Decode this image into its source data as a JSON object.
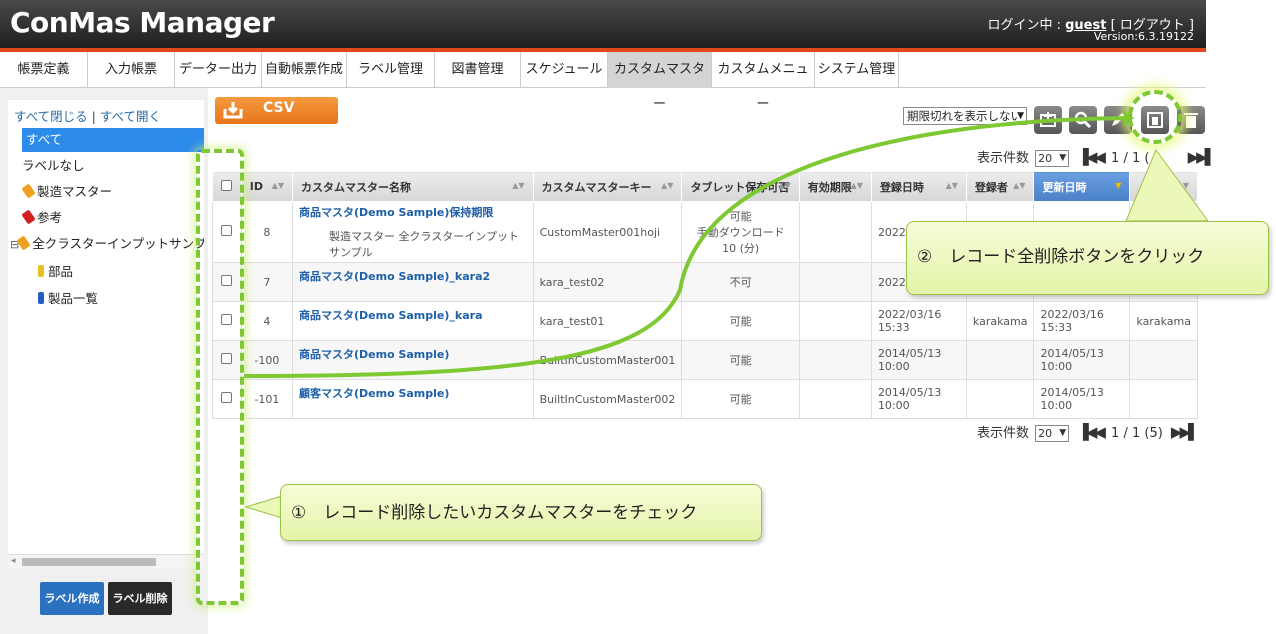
{
  "header": {
    "app_title": "ConMas Manager",
    "login_prefix": "ログイン中 : ",
    "user": "guest",
    "logout": "[ ログアウト ]",
    "version": "Version:6.3.19122"
  },
  "nav": {
    "tabs": [
      {
        "label": "帳票定義"
      },
      {
        "label": "入力帳票"
      },
      {
        "label": "データー出力"
      },
      {
        "label": "自動帳票作成"
      },
      {
        "label": "ラベル管理"
      },
      {
        "label": "図書管理"
      },
      {
        "label": "スケジュール"
      },
      {
        "label": "カスタムマスター",
        "active": true
      },
      {
        "label": "カスタムメニュー"
      },
      {
        "label": "システム管理"
      }
    ]
  },
  "sidebar": {
    "collapse_all": "すべて閉じる",
    "separator": "|",
    "expand_all": "すべて開く",
    "items": [
      {
        "label": "すべて"
      },
      {
        "label": "ラベルなし"
      },
      {
        "label": "製造マスター"
      },
      {
        "label": "参考"
      },
      {
        "label": "全クラスターインプットサンプル"
      },
      {
        "label": "部品"
      },
      {
        "label": "製品一覧"
      }
    ],
    "tree_toggle": "⊟",
    "create_label": "ラベル作成",
    "delete_label": "ラベル削除"
  },
  "toolbar": {
    "csv_label": "CSV",
    "filter_value": "期限切れを表示しない",
    "icons": [
      "add-icon",
      "search-icon",
      "edit-icon",
      "delete-all-records-icon",
      "trash-icon"
    ]
  },
  "pager": {
    "per_page_label": "表示件数",
    "per_page_value": "20",
    "page_info_top": "1 / 1 (",
    "page_info_bottom": "1 / 1 (5)"
  },
  "table": {
    "columns": [
      "ID",
      "カスタムマスター名称",
      "カスタムマスターキー",
      "タブレット保存可否",
      "有効期限",
      "登録日時",
      "登録者",
      "更新日時",
      ""
    ],
    "rows": [
      {
        "id": "8",
        "name": "商品マスタ(Demo Sample)保持期限",
        "labels": "製造マスター 全クラスターインプットサンプル",
        "key": "CustomMaster001hoji",
        "tablet": [
          "可能",
          "手動ダウンロード",
          "10 (分)"
        ],
        "expiry": "",
        "created": "2022/",
        "creator": "",
        "updated": "",
        "updater": ""
      },
      {
        "id": "7",
        "name": "商品マスタ(Demo Sample)_kara2",
        "labels": "",
        "key": "kara_test02",
        "tablet": [
          "不可"
        ],
        "expiry": "",
        "created": "2022/",
        "creator": "",
        "updated": "",
        "updater": ""
      },
      {
        "id": "4",
        "name": "商品マスタ(Demo Sample)_kara",
        "labels": "",
        "key": "kara_test01",
        "tablet": [
          "可能"
        ],
        "expiry": "",
        "created": "2022/03/16 15:33",
        "creator": "karakama",
        "updated": "2022/03/16 15:33",
        "updater": "karakama"
      },
      {
        "id": "-100",
        "name": "商品マスタ(Demo Sample)",
        "labels": "",
        "key": "BuiltInCustomMaster001",
        "tablet": [
          "可能"
        ],
        "expiry": "",
        "created": "2014/05/13 10:00",
        "creator": "",
        "updated": "2014/05/13 10:00",
        "updater": ""
      },
      {
        "id": "-101",
        "name": "顧客マスタ(Demo Sample)",
        "labels": "",
        "key": "BuiltInCustomMaster002",
        "tablet": [
          "可能"
        ],
        "expiry": "",
        "created": "2014/05/13 10:00",
        "creator": "",
        "updated": "2014/05/13 10:00",
        "updater": ""
      }
    ]
  },
  "callouts": {
    "step1": "①　レコード削除したいカスタムマスターをチェック",
    "step2": "②　レコード全削除ボタンをクリック"
  },
  "colors": {
    "accent_green": "#7ec832",
    "header_red": "#e04a1a",
    "link_blue": "#1e5fa8",
    "selected_blue": "#2d8cea"
  }
}
